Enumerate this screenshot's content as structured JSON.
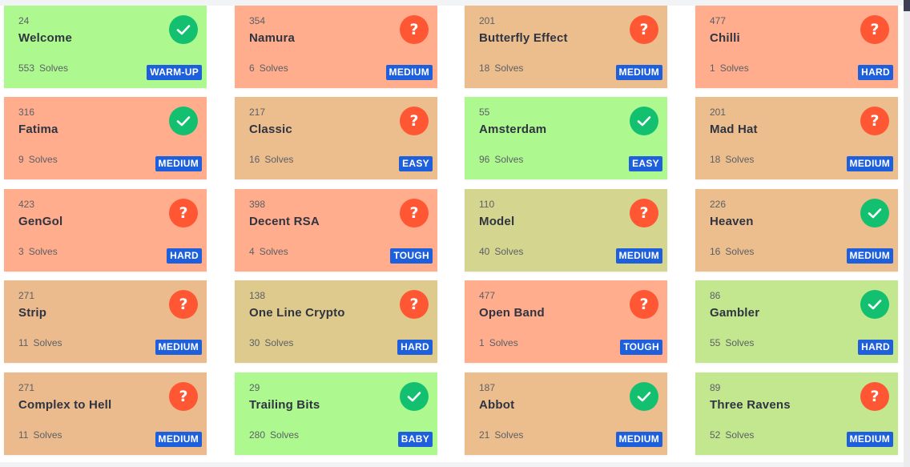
{
  "solves_label": "Solves",
  "status_glyphs": {
    "unsolved": "?"
  },
  "colors": {
    "green": "#adf98f",
    "orange": "#ffad8d",
    "peach": "#ecbe8e",
    "sand": "#ebbb8e",
    "olive": "#d4d58f",
    "khaki": "#ddca8c",
    "lime": "#c3e78e",
    "solved_icon": "#12c070",
    "unsolved_icon": "#ff5634",
    "badge": "#1e5fdc"
  },
  "challenges": [
    {
      "points": "24",
      "name": "Welcome",
      "solves": "553",
      "difficulty": "WARM-UP",
      "solved": true,
      "color": "green"
    },
    {
      "points": "354",
      "name": "Namura",
      "solves": "6",
      "difficulty": "MEDIUM",
      "solved": false,
      "color": "orange"
    },
    {
      "points": "201",
      "name": "Butterfly Effect",
      "solves": "18",
      "difficulty": "MEDIUM",
      "solved": false,
      "color": "peach"
    },
    {
      "points": "477",
      "name": "Chilli",
      "solves": "1",
      "difficulty": "HARD",
      "solved": false,
      "color": "orange"
    },
    {
      "points": "316",
      "name": "Fatima",
      "solves": "9",
      "difficulty": "MEDIUM",
      "solved": true,
      "color": "orange"
    },
    {
      "points": "217",
      "name": "Classic",
      "solves": "16",
      "difficulty": "EASY",
      "solved": false,
      "color": "peach"
    },
    {
      "points": "55",
      "name": "Amsterdam",
      "solves": "96",
      "difficulty": "EASY",
      "solved": true,
      "color": "green"
    },
    {
      "points": "201",
      "name": "Mad Hat",
      "solves": "18",
      "difficulty": "MEDIUM",
      "solved": false,
      "color": "peach"
    },
    {
      "points": "423",
      "name": "GenGol",
      "solves": "3",
      "difficulty": "HARD",
      "solved": false,
      "color": "orange"
    },
    {
      "points": "398",
      "name": "Decent RSA",
      "solves": "4",
      "difficulty": "TOUGH",
      "solved": false,
      "color": "orange"
    },
    {
      "points": "110",
      "name": "Model",
      "solves": "40",
      "difficulty": "MEDIUM",
      "solved": false,
      "color": "olive"
    },
    {
      "points": "226",
      "name": "Heaven",
      "solves": "16",
      "difficulty": "MEDIUM",
      "solved": true,
      "color": "peach"
    },
    {
      "points": "271",
      "name": "Strip",
      "solves": "11",
      "difficulty": "MEDIUM",
      "solved": false,
      "color": "sand"
    },
    {
      "points": "138",
      "name": "One Line Crypto",
      "solves": "30",
      "difficulty": "HARD",
      "solved": false,
      "color": "khaki"
    },
    {
      "points": "477",
      "name": "Open Band",
      "solves": "1",
      "difficulty": "TOUGH",
      "solved": false,
      "color": "orange"
    },
    {
      "points": "86",
      "name": "Gambler",
      "solves": "55",
      "difficulty": "HARD",
      "solved": true,
      "color": "lime"
    },
    {
      "points": "271",
      "name": "Complex to Hell",
      "solves": "11",
      "difficulty": "MEDIUM",
      "solved": false,
      "color": "sand"
    },
    {
      "points": "29",
      "name": "Trailing Bits",
      "solves": "280",
      "difficulty": "BABY",
      "solved": true,
      "color": "green"
    },
    {
      "points": "187",
      "name": "Abbot",
      "solves": "21",
      "difficulty": "MEDIUM",
      "solved": true,
      "color": "peach"
    },
    {
      "points": "89",
      "name": "Three Ravens",
      "solves": "52",
      "difficulty": "MEDIUM",
      "solved": false,
      "color": "lime"
    }
  ]
}
